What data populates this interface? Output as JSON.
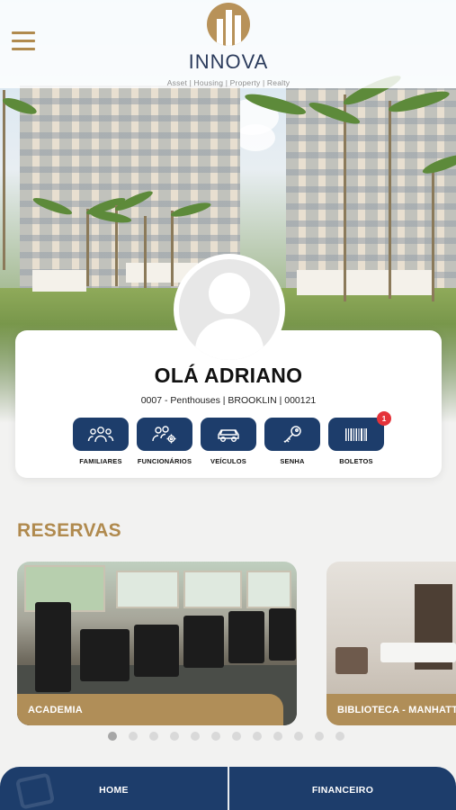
{
  "header": {
    "brand_name": "INNOVA",
    "brand_tagline": "Asset | Housing | Property | Realty",
    "menu_icon": "hamburger-menu-icon"
  },
  "profile": {
    "greeting": "OLÁ ADRIANO",
    "unit_info": "0007 - Penthouses | BROOKLIN | 000121",
    "actions": [
      {
        "label": "FAMILIARES",
        "icon": "family-icon"
      },
      {
        "label": "FUNCIONÁRIOS",
        "icon": "employees-icon"
      },
      {
        "label": "VEÍCULOS",
        "icon": "car-icon"
      },
      {
        "label": "SENHA",
        "icon": "key-icon"
      },
      {
        "label": "BOLETOS",
        "icon": "barcode-icon",
        "badge": "1"
      }
    ]
  },
  "reservas": {
    "title": "RESERVAS",
    "items": [
      {
        "label": "ACADEMIA"
      },
      {
        "label": "BIBLIOTECA - MANHATTAN"
      }
    ],
    "page_count": 12,
    "active_page": 1
  },
  "bottom_nav": {
    "items": [
      {
        "label": "HOME"
      },
      {
        "label": "FINANCEIRO"
      }
    ]
  },
  "colors": {
    "primary_navy": "#1d3d6b",
    "accent_gold": "#b08a4e",
    "badge_red": "#e5333a"
  }
}
